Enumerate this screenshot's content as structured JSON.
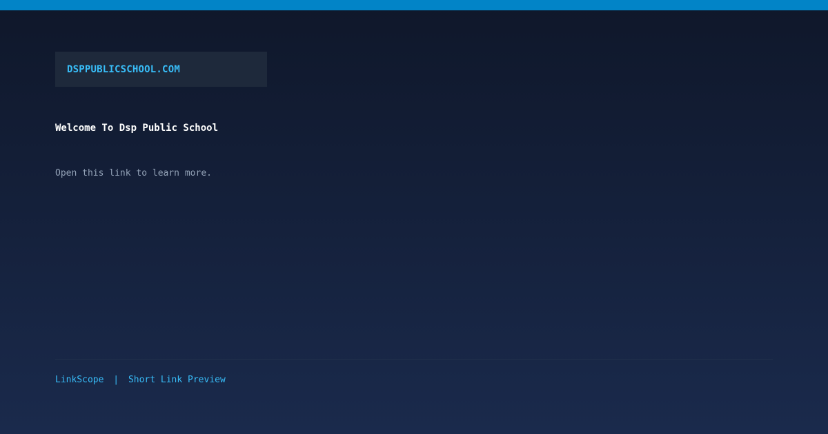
{
  "colors": {
    "accent_bar": "#0284c7",
    "link": "#38bdf8",
    "background_top": "#0f172a",
    "background_bottom": "#1a2a4c",
    "domain_box": "#1e293b"
  },
  "domain": {
    "text": "DSPPUBLICSCHOOL.COM"
  },
  "content": {
    "title": "Welcome To Dsp Public School",
    "description": "Open this link to learn more."
  },
  "footer": {
    "brand": "LinkScope",
    "separator": "|",
    "tagline": "Short Link Preview"
  }
}
